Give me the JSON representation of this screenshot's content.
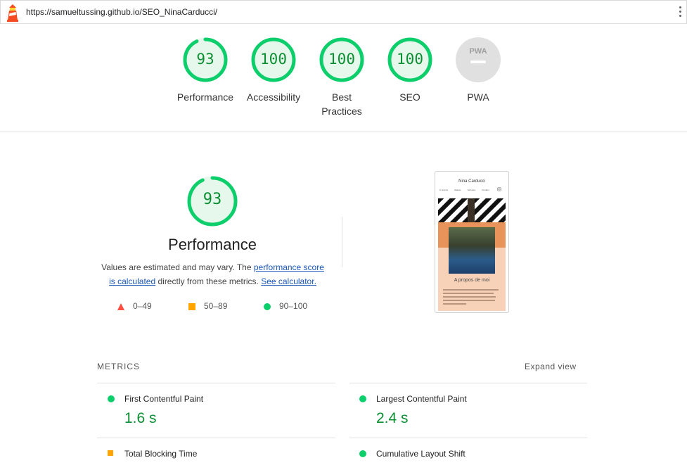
{
  "browser": {
    "url": "https://samueltussing.github.io/SEO_NinaCarducci/",
    "logo_icon": "lighthouse-icon",
    "menu_icon": "kebab-menu-icon"
  },
  "colors": {
    "pass_green": "#0cce6b",
    "score_text_green": "#0c8f33",
    "average_orange": "#ffa400",
    "fail_red": "#ff4e42",
    "pwa_gray": "#e0e0e0",
    "link_blue": "#1a56b8"
  },
  "scores": [
    {
      "label": "Performance",
      "value": "93",
      "fraction": 0.93
    },
    {
      "label": "Accessibility",
      "value": "100",
      "fraction": 1.0
    },
    {
      "label": "Best\nPractices",
      "value": "100",
      "fraction": 1.0
    },
    {
      "label": "SEO",
      "value": "100",
      "fraction": 1.0
    },
    {
      "label": "PWA",
      "value": "PWA",
      "fraction": 0
    }
  ],
  "performance": {
    "score": "93",
    "fraction": 0.93,
    "title": "Performance",
    "desc_prefix": "Values are estimated and may vary. The ",
    "desc_link1": "performance score is calculated",
    "desc_mid": " directly from these metrics. ",
    "desc_link2": "See calculator.",
    "legend": [
      "0–49",
      "50–89",
      "90–100"
    ]
  },
  "screenshot": {
    "site_title": "Nina Carducci",
    "nav": [
      "À propos",
      "Galerie",
      "Services",
      "Contact"
    ],
    "section_title": "A propos de moi"
  },
  "metrics": {
    "heading": "METRICS",
    "expand_label": "Expand view",
    "items": [
      {
        "label": "First Contentful Paint",
        "value": "1.6 s",
        "status": "pass"
      },
      {
        "label": "Largest Contentful Paint",
        "value": "2.4 s",
        "status": "pass"
      },
      {
        "label": "Total Blocking Time",
        "value": "",
        "status": "average"
      },
      {
        "label": "Cumulative Layout Shift",
        "value": "",
        "status": "pass"
      }
    ]
  }
}
